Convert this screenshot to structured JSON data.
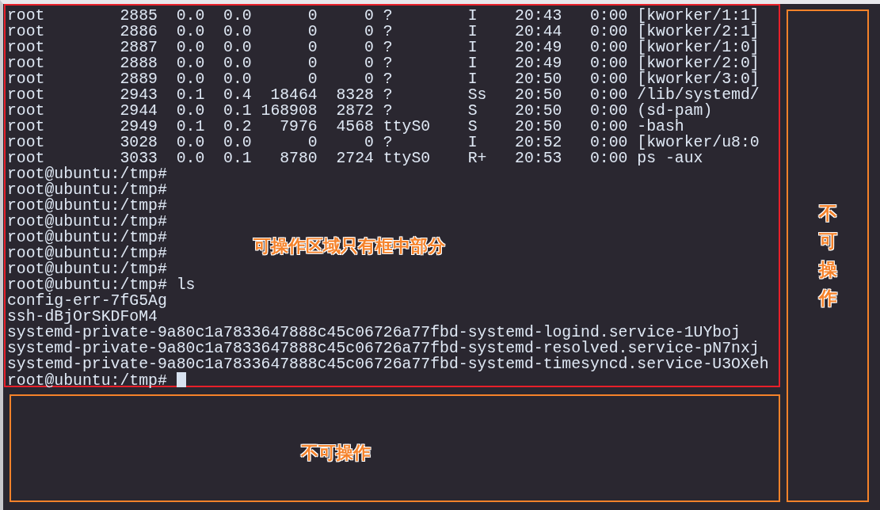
{
  "terminal": {
    "lines": [
      "root        2885  0.0  0.0      0     0 ?        I    20:43   0:00 [kworker/1:1]",
      "root        2886  0.0  0.0      0     0 ?        I    20:44   0:00 [kworker/2:1]",
      "root        2887  0.0  0.0      0     0 ?        I    20:49   0:00 [kworker/1:0]",
      "root        2888  0.0  0.0      0     0 ?        I    20:49   0:00 [kworker/2:0]",
      "root        2889  0.0  0.0      0     0 ?        I    20:50   0:00 [kworker/3:0]",
      "root        2943  0.1  0.4  18464  8328 ?        Ss   20:50   0:00 /lib/systemd/",
      "root        2944  0.0  0.1 168908  2872 ?        S    20:50   0:00 (sd-pam)",
      "root        2949  0.1  0.2   7976  4568 ttyS0    S    20:50   0:00 -bash",
      "root        3028  0.0  0.0      0     0 ?        I    20:52   0:00 [kworker/u8:0",
      "root        3033  0.0  0.1   8780  2724 ttyS0    R+   20:53   0:00 ps -aux",
      "root@ubuntu:/tmp#",
      "root@ubuntu:/tmp#",
      "root@ubuntu:/tmp#",
      "root@ubuntu:/tmp#",
      "root@ubuntu:/tmp#",
      "root@ubuntu:/tmp#",
      "root@ubuntu:/tmp#",
      "root@ubuntu:/tmp# ls",
      "config-err-7fG5Ag",
      "ssh-dBjOrSKDFoM4",
      "systemd-private-9a80c1a7833647888c45c06726a77fbd-systemd-logind.service-1UYboj",
      "systemd-private-9a80c1a7833647888c45c06726a77fbd-systemd-resolved.service-pN7nxj",
      "systemd-private-9a80c1a7833647888c45c06726a77fbd-systemd-timesyncd.service-U3OXeh",
      "root@ubuntu:/tmp# "
    ],
    "cursor": true
  },
  "annotations": {
    "operable_area": {
      "label": "可操作区域只有框中部分"
    },
    "bottom_area": {
      "label": "不可操作"
    },
    "side_area": {
      "label": "不可操作"
    }
  }
}
